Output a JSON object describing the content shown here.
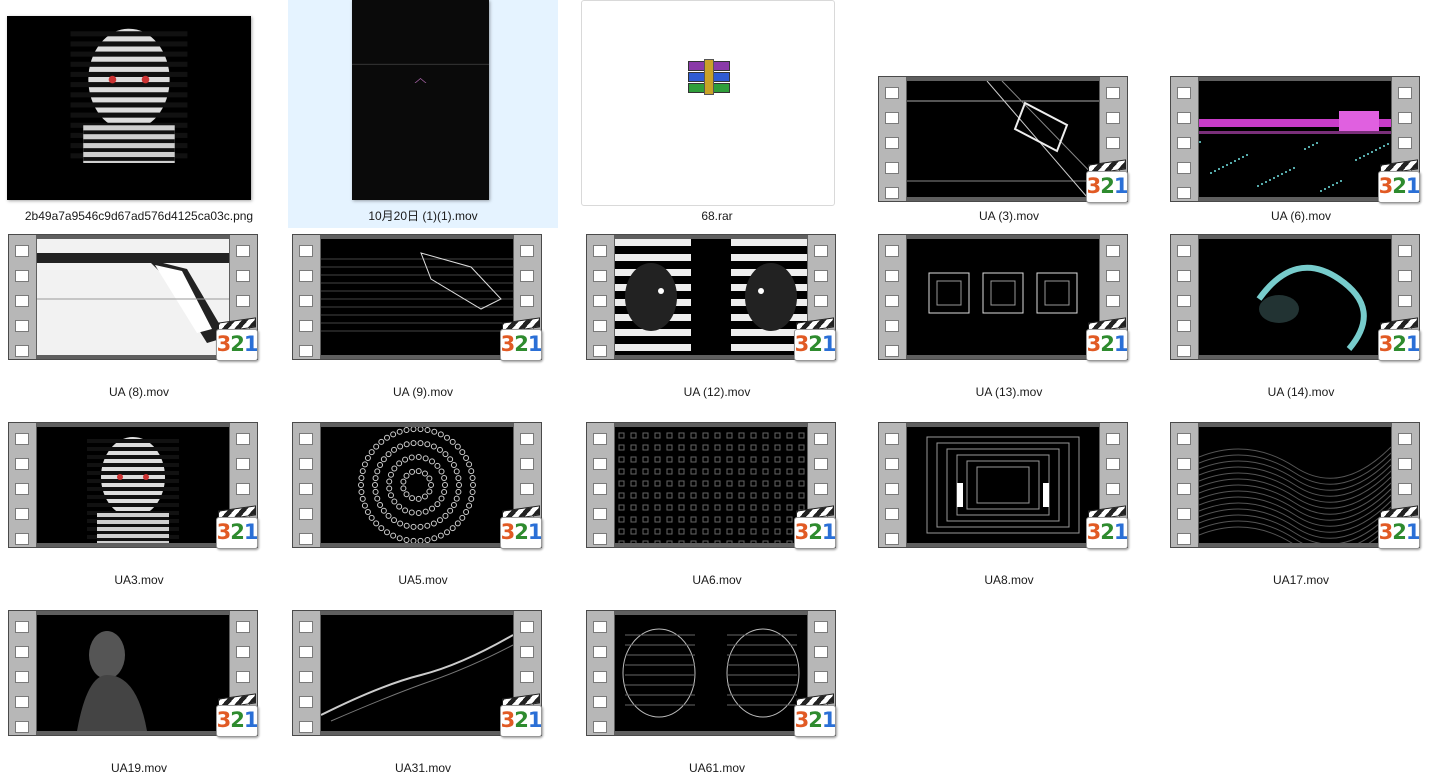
{
  "files": [
    {
      "name": "2b49a7a9546c9d67ad576d4125ca03c.png",
      "kind": "png",
      "thumb": "zebra-face"
    },
    {
      "name": "10月20日 (1)(1).mov",
      "kind": "tallvideo",
      "thumb": "dark-cube",
      "selected": true
    },
    {
      "name": "68.rar",
      "kind": "rar"
    },
    {
      "name": "UA (3).mov",
      "kind": "video",
      "thumb": "lines"
    },
    {
      "name": "UA (6).mov",
      "kind": "video",
      "thumb": "purple"
    },
    {
      "name": "UA (8).mov",
      "kind": "video",
      "thumb": "white-beam"
    },
    {
      "name": "UA (9).mov",
      "kind": "video",
      "thumb": "diag-glitch"
    },
    {
      "name": "UA (12).mov",
      "kind": "video",
      "thumb": "twin-heads"
    },
    {
      "name": "UA (13).mov",
      "kind": "video",
      "thumb": "cubes"
    },
    {
      "name": "UA (14).mov",
      "kind": "video",
      "thumb": "teal-swirl"
    },
    {
      "name": "UA3.mov",
      "kind": "video",
      "thumb": "zebra-face"
    },
    {
      "name": "UA5.mov",
      "kind": "video",
      "thumb": "circles"
    },
    {
      "name": "UA6.mov",
      "kind": "video",
      "thumb": "pattern"
    },
    {
      "name": "UA8.mov",
      "kind": "video",
      "thumb": "tunnel"
    },
    {
      "name": "UA17.mov",
      "kind": "video",
      "thumb": "waves"
    },
    {
      "name": "UA19.mov",
      "kind": "video",
      "thumb": "statue"
    },
    {
      "name": "UA31.mov",
      "kind": "video",
      "thumb": "lightning"
    },
    {
      "name": "UA61.mov",
      "kind": "video",
      "thumb": "wire-heads"
    }
  ],
  "badge_digits": [
    "3",
    "2",
    "1"
  ],
  "icons": {
    "video_badge": "media-player-321-icon",
    "archive": "winrar-icon"
  },
  "colors": {
    "selection": "#e5f3ff",
    "film": "#b7b7b7",
    "d3": "#e15a24",
    "d2": "#2e8b2e",
    "d1": "#2a6fd6"
  }
}
